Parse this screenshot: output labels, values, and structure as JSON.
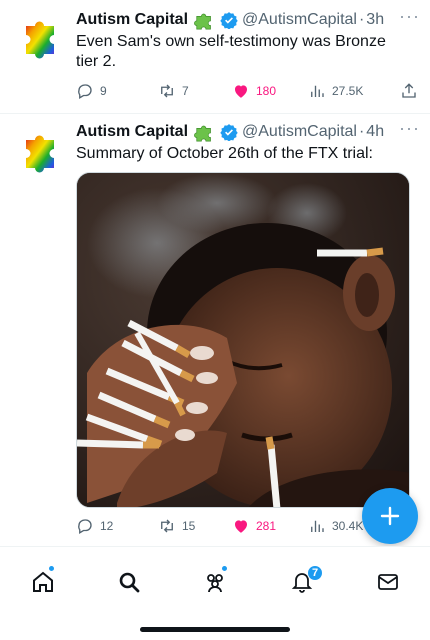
{
  "colors": {
    "accent": "#1d9bf0",
    "like": "#f91880",
    "muted": "#536471",
    "text": "#0f1419"
  },
  "tweets": [
    {
      "author": "Autism Capital",
      "badge_icon": "puzzle-piece-icon",
      "verified_icon": "verified-badge-icon",
      "handle": "@AutismCapital",
      "separator": "·",
      "time": "3h",
      "more": "···",
      "text": "Even Sam's own self-testimony was Bronze tier 2.",
      "replies": "9",
      "retweets": "7",
      "likes": "180",
      "liked": true,
      "views": "27.5K"
    },
    {
      "author": "Autism Capital",
      "badge_icon": "puzzle-piece-icon",
      "verified_icon": "verified-badge-icon",
      "handle": "@AutismCapital",
      "separator": "·",
      "time": "4h",
      "more": "···",
      "text": "Summary of October 26th of the FTX trial:",
      "media": "photo of a man holding his head, fingers holding many cigarettes, cigarette in mouth",
      "replies": "12",
      "retweets": "15",
      "likes": "281",
      "liked": true,
      "views": "30.4K"
    }
  ],
  "fab": {
    "icon": "plus-icon"
  },
  "tabbar": {
    "items": [
      {
        "icon": "home-icon",
        "has_dot": true
      },
      {
        "icon": "search-icon",
        "has_dot": false
      },
      {
        "icon": "communities-icon",
        "has_dot": true
      },
      {
        "icon": "notifications-icon",
        "badge": "7"
      },
      {
        "icon": "messages-icon",
        "has_dot": false
      }
    ]
  }
}
